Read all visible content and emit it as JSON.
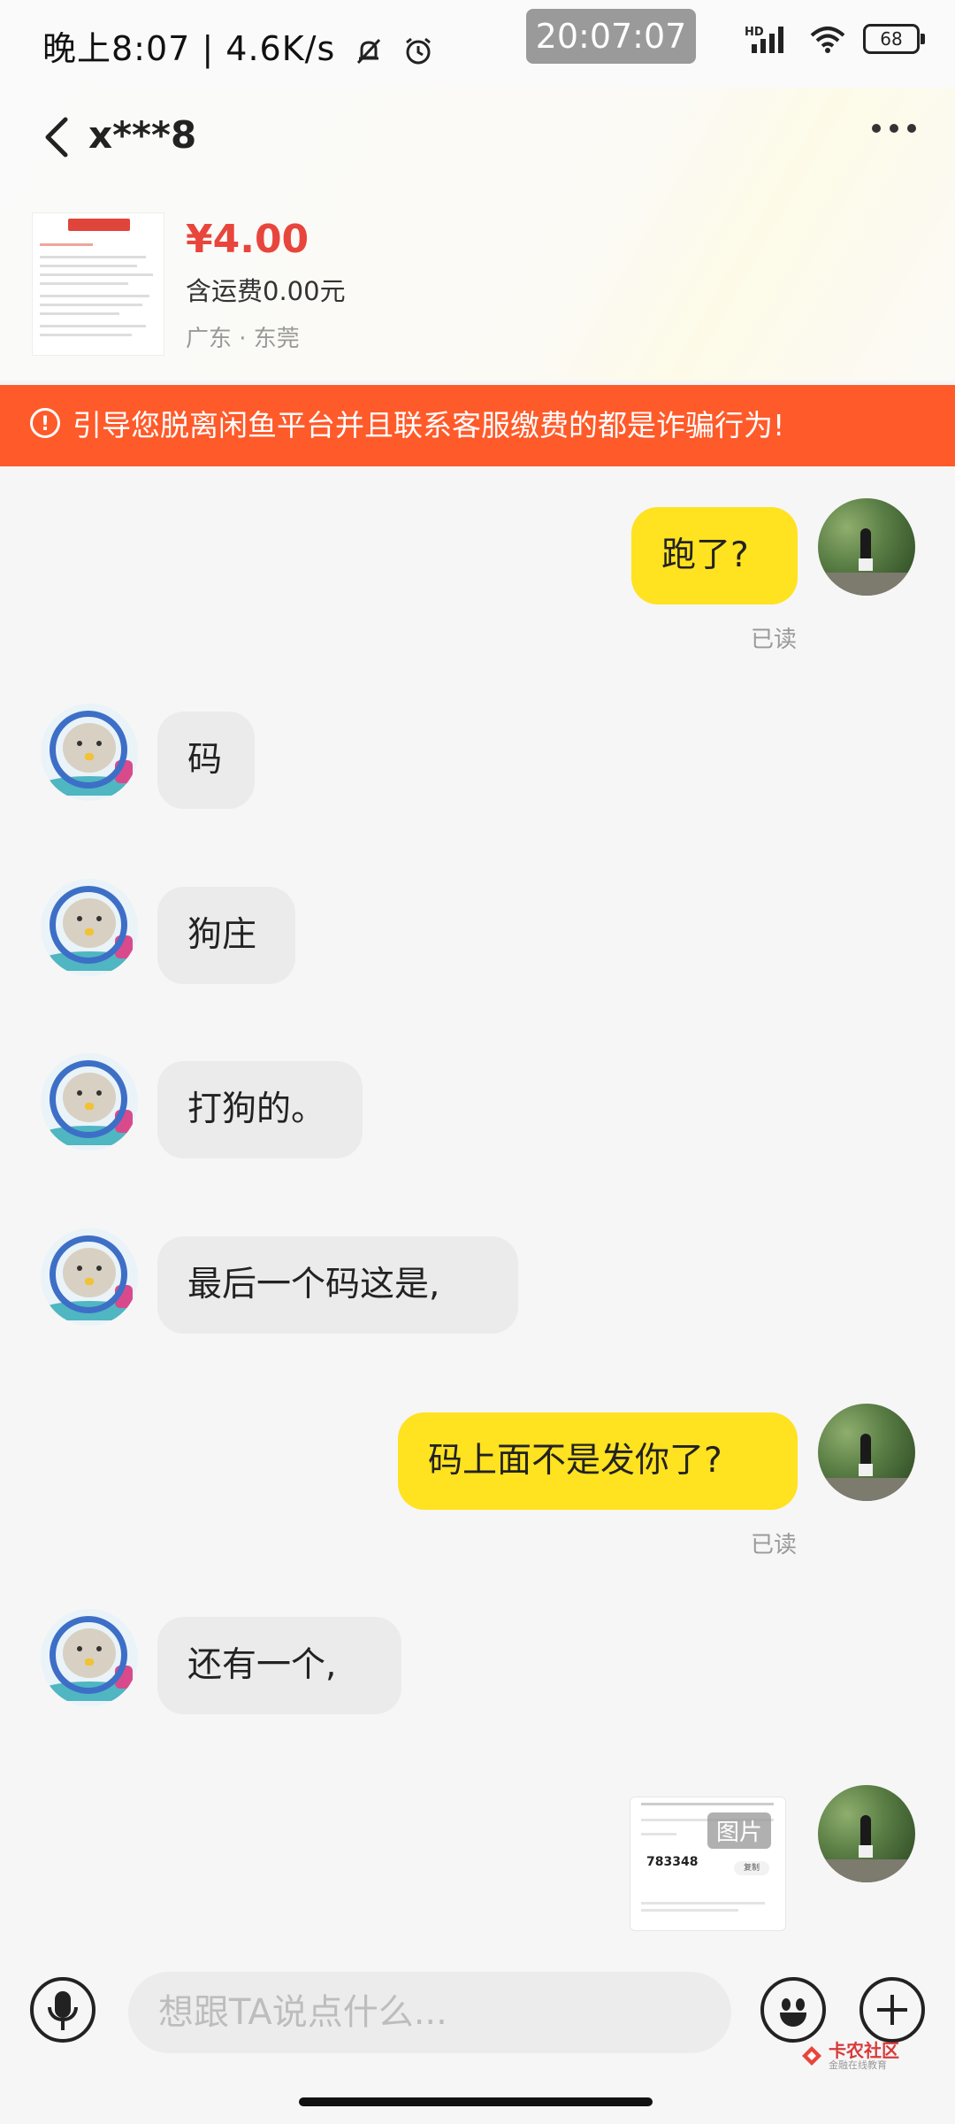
{
  "status_bar": {
    "left_text": "晚上8:07 | 4.6K/s",
    "clock": "20:07:07",
    "network": "HD",
    "battery": "68"
  },
  "header": {
    "title": "x***8"
  },
  "product": {
    "price": "¥4.00",
    "shipping": "含运费0.00元",
    "location": "广东 · 东莞"
  },
  "warning": {
    "text": "引导您脱离闲鱼平台并且联系客服缴费的都是诈骗行为!"
  },
  "messages": [
    {
      "from": "me",
      "text": "跑了?",
      "status": "已读"
    },
    {
      "from": "other",
      "text": "码"
    },
    {
      "from": "other",
      "text": "狗庄"
    },
    {
      "from": "other",
      "text": "打狗的。"
    },
    {
      "from": "other",
      "text": "最后一个码这是,"
    },
    {
      "from": "me",
      "text": "码上面不是发你了?",
      "status": "已读"
    },
    {
      "from": "other",
      "text": "还有一个,"
    },
    {
      "from": "me",
      "type": "image",
      "tag": "图片",
      "image_code": "783348",
      "image_copy": "复制"
    }
  ],
  "input": {
    "placeholder": "想跟TA说点什么..."
  },
  "watermark": {
    "title": "卡农社区",
    "subtitle": "金融在线教育"
  },
  "icons": [
    "back-arrow-icon",
    "more-dots-icon",
    "warning-icon",
    "microphone-icon",
    "emoji-icon",
    "plus-icon",
    "silent-bell-icon",
    "alarm-icon",
    "signal-icon",
    "wifi-icon",
    "battery-icon"
  ]
}
